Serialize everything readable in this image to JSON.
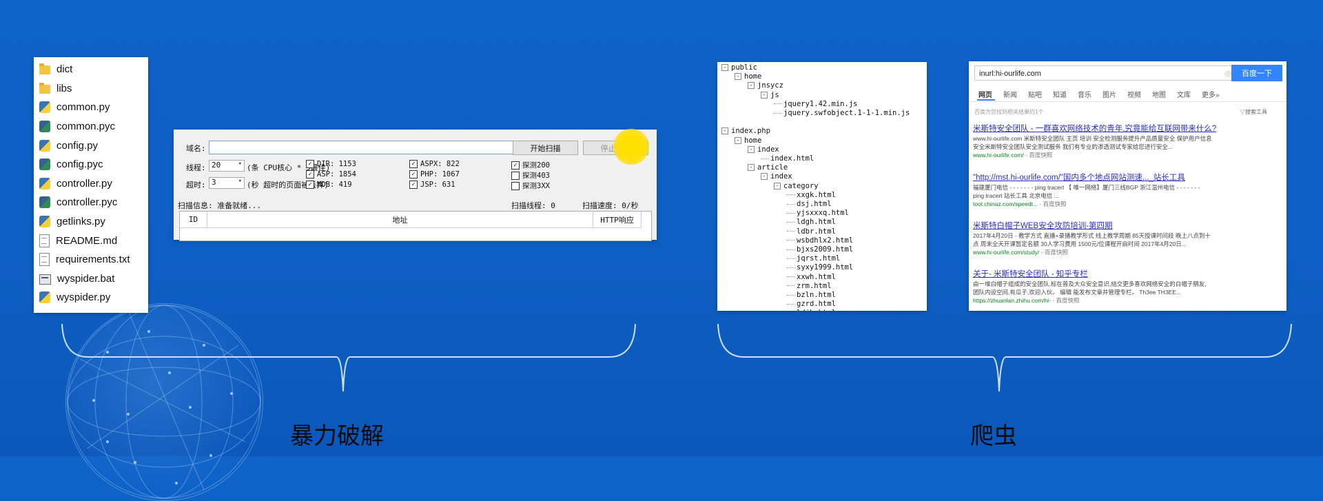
{
  "files": [
    {
      "name": "dict",
      "type": "folder"
    },
    {
      "name": "libs",
      "type": "folder"
    },
    {
      "name": "common.py",
      "type": "py"
    },
    {
      "name": "common.pyc",
      "type": "pyc"
    },
    {
      "name": "config.py",
      "type": "py"
    },
    {
      "name": "config.pyc",
      "type": "pyc"
    },
    {
      "name": "controller.py",
      "type": "py"
    },
    {
      "name": "controller.pyc",
      "type": "pyc"
    },
    {
      "name": "getlinks.py",
      "type": "py"
    },
    {
      "name": "README.md",
      "type": "txt"
    },
    {
      "name": "requirements.txt",
      "type": "txt"
    },
    {
      "name": "wyspider.bat",
      "type": "bat"
    },
    {
      "name": "wyspider.py",
      "type": "py"
    }
  ],
  "scanner": {
    "domain_label": "域名:",
    "domain_value": "",
    "start_button": "开始扫描",
    "stop_button": "停止扫描",
    "threads_label": "线程:",
    "threads_value": "20",
    "threads_hint": "(条 CPU核心 * 5最佳)",
    "timeout_label": "超时:",
    "timeout_value": "3",
    "timeout_hint": "(秒 超时的页面被丢弃)",
    "checks_col1": [
      {
        "label": "DIR: 1153",
        "checked": true
      },
      {
        "label": "ASP: 1854",
        "checked": true
      },
      {
        "label": "MDB: 419",
        "checked": true
      }
    ],
    "checks_col2": [
      {
        "label": "ASPX: 822",
        "checked": true
      },
      {
        "label": "PHP: 1067",
        "checked": true
      },
      {
        "label": "JSP: 631",
        "checked": true
      }
    ],
    "checks_col3": [
      {
        "label": "探测200",
        "checked": true
      },
      {
        "label": "探测403",
        "checked": false
      },
      {
        "label": "探测3XX",
        "checked": false
      }
    ],
    "status_info": "扫描信息: 准备就绪...",
    "status_threads": "扫描线程: 0",
    "status_speed": "扫描速度: 0/秒",
    "columns": [
      "ID",
      "地址",
      "HTTP响应"
    ]
  },
  "tree": [
    {
      "label": "public",
      "level": 0,
      "toggle": "-"
    },
    {
      "label": "home",
      "level": 1,
      "toggle": "-"
    },
    {
      "label": "jnsycz",
      "level": 2,
      "toggle": "-"
    },
    {
      "label": "js",
      "level": 3,
      "toggle": "-"
    },
    {
      "label": "jquery1.42.min.js",
      "level": 4,
      "toggle": ""
    },
    {
      "label": "jquery.swfobject.1-1-1.min.js",
      "level": 4,
      "toggle": ""
    },
    {
      "label": "",
      "level": 0,
      "toggle": ""
    },
    {
      "label": "index.php",
      "level": 0,
      "toggle": "-"
    },
    {
      "label": "home",
      "level": 1,
      "toggle": "-"
    },
    {
      "label": "index",
      "level": 2,
      "toggle": "-"
    },
    {
      "label": "index.html",
      "level": 3,
      "toggle": ""
    },
    {
      "label": "article",
      "level": 2,
      "toggle": "-"
    },
    {
      "label": "index",
      "level": 3,
      "toggle": "-"
    },
    {
      "label": "category",
      "level": 4,
      "toggle": "-"
    },
    {
      "label": "xxgk.html",
      "level": 5,
      "toggle": ""
    },
    {
      "label": "dsj.html",
      "level": 5,
      "toggle": ""
    },
    {
      "label": "yjsxxxq.html",
      "level": 5,
      "toggle": ""
    },
    {
      "label": "ldgh.html",
      "level": 5,
      "toggle": ""
    },
    {
      "label": "ldbr.html",
      "level": 5,
      "toggle": ""
    },
    {
      "label": "wsbdhlx2.html",
      "level": 5,
      "toggle": ""
    },
    {
      "label": "bjxs2009.html",
      "level": 5,
      "toggle": ""
    },
    {
      "label": "jqrst.html",
      "level": 5,
      "toggle": ""
    },
    {
      "label": "syxy1999.html",
      "level": 5,
      "toggle": ""
    },
    {
      "label": "xxwh.html",
      "level": 5,
      "toggle": ""
    },
    {
      "label": "zrm.html",
      "level": 5,
      "toggle": ""
    },
    {
      "label": "bzln.html",
      "level": 5,
      "toggle": ""
    },
    {
      "label": "gzrd.html",
      "level": 5,
      "toggle": ""
    },
    {
      "label": "ldjh.html",
      "level": 5,
      "toggle": ""
    }
  ],
  "search": {
    "query": "inurl:hi-ourlife.com",
    "button": "百度一下",
    "tabs": [
      "网页",
      "新闻",
      "贴吧",
      "知道",
      "音乐",
      "图片",
      "视频",
      "地图",
      "文库",
      "更多»"
    ],
    "count_text": "百度为您找到相关结果约1个",
    "tools": "搜索工具",
    "results": [
      {
        "title": "米斯特安全团队 - 一群喜欢网络技术的青年,究竟能给互联网带来什么?",
        "desc1": "www.hi-ourlife.com 米斯特安全团队 主页 培训 安全检测服务提升产品质量安全 保护用户信息",
        "desc2": "安全米斯特安全团队安全测试服务 我们有专业的渗透测试专家给您进行安全...",
        "url": "www.hi-ourlife.com/",
        "snap": "- 百度快照"
      },
      {
        "title": "\"http://mst.hi-ourlife.com/\"国内多个地点网站测速..._站长工具",
        "desc1": "福建厦门电信 - - - - - - - ping tracert 【 唯一网络】厦门三线BGP 浙江温州电信 - - - - - - -",
        "desc2": "ping tracert 站长工具 北京电信 ...",
        "url": "tool.chinaz.com/speedt...",
        "snap": "- 百度快照"
      },
      {
        "title": "米斯特白帽子WEB安全攻防培训-第四期",
        "desc1": "2017年4月20日 - 教学方式 直播+录播教学形式 线上教学周期 85天授课时间段 晚上八点到十",
        "desc2": "点 周末全天开课暂定名额 30人学习费用 1500元/位课程开启时间 2017年4月20日...",
        "url": "www.hi-ourlife.com/study/",
        "snap": "- 百度快照"
      },
      {
        "title": "关于- 米斯特安全团队 - 知乎专栏",
        "desc1": "由一堆白帽子组成的安全团队,标在普及大众安全意识,结交更多喜欢网络安全的白帽子朋友,",
        "desc2": "团队内设空间,有瓜子,欢迎入伙。 编辑 能发布文章并管理专栏。 Th3ee TH3EE...",
        "url": "https://zhuanlan.zhihu.com/hi-",
        "snap": "- 百度快照"
      }
    ]
  },
  "captions": {
    "left": "暴力破解",
    "right": "爬虫"
  }
}
